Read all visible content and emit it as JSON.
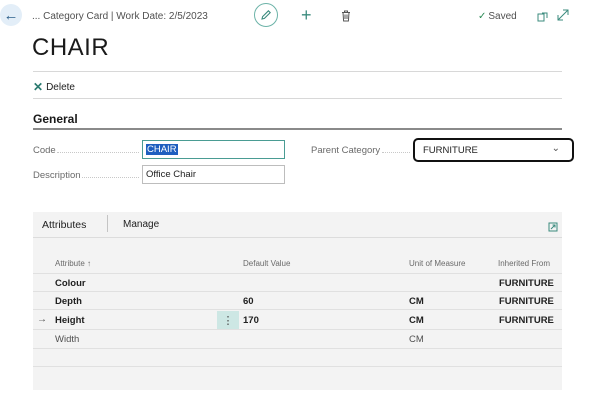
{
  "header": {
    "breadcrumb": "... Category Card | Work Date: 2/5/2023",
    "saved_label": "Saved"
  },
  "page_title": "CHAIR",
  "actions": {
    "delete_label": "Delete"
  },
  "general": {
    "title": "General",
    "code_label": "Code",
    "code_value": "CHAIR",
    "description_label": "Description",
    "description_value": "Office Chair",
    "parent_category_label": "Parent Category",
    "parent_category_value": "FURNITURE"
  },
  "attributes": {
    "tabs": {
      "attributes": "Attributes",
      "manage": "Manage"
    },
    "columns": {
      "attribute": "Attribute ↑",
      "default_value": "Default Value",
      "unit_of_measure": "Unit of Measure",
      "inherited_from": "Inherited From"
    },
    "rows": [
      {
        "attribute": "Colour",
        "default_value": "",
        "unit_of_measure": "",
        "inherited_from": "FURNITURE",
        "bold": true,
        "selected": false
      },
      {
        "attribute": "Depth",
        "default_value": "60",
        "unit_of_measure": "CM",
        "inherited_from": "FURNITURE",
        "bold": true,
        "selected": false
      },
      {
        "attribute": "Height",
        "default_value": "170",
        "unit_of_measure": "CM",
        "inherited_from": "FURNITURE",
        "bold": true,
        "selected": true
      },
      {
        "attribute": "Width",
        "default_value": "",
        "unit_of_measure": "CM",
        "inherited_from": "",
        "bold": false,
        "selected": false
      }
    ]
  },
  "colors": {
    "accent": "#3b8b7e",
    "selection": "#1f5fbf",
    "selected_row_button": "#cde7e4"
  }
}
